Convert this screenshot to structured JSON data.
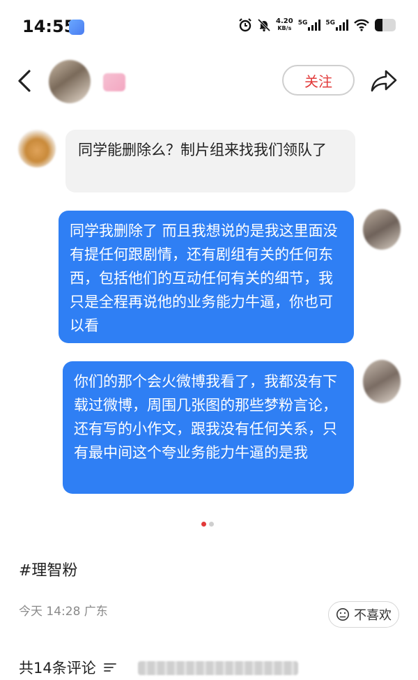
{
  "status_bar": {
    "time": "14:55",
    "net_speed_value": "4.20",
    "net_speed_unit": "KB/s",
    "signal_1": "5G",
    "signal_2": "5G",
    "battery_level": 0.35
  },
  "header": {
    "follow_label": "关注"
  },
  "messages": [
    {
      "side": "left",
      "text": "同学能删除么？制片组来找我们领队了"
    },
    {
      "side": "right",
      "text": "同学我删除了 而且我想说的是我这里面没有提任何跟剧情，还有剧组有关的任何东西，包括他们的互动任何有关的细节，我只是全程再说他的业务能力牛逼，你也可以看"
    },
    {
      "side": "right",
      "text": "你们的那个会火微博我看了，我都没有下载过微博，周围几张图的那些梦粉言论，还有写的小作文，跟我没有任何关系，只有最中间这个夸业务能力牛逼的是我"
    }
  ],
  "carousel": {
    "current": 1,
    "total": 2
  },
  "post": {
    "tag": "#理智粉",
    "meta": "今天 14:28  广东",
    "dislike_label": "不喜欢",
    "comment_count_label": "共14条评论"
  },
  "colors": {
    "accent_red": "#e23a3a",
    "bubble_blue": "#2f7ff4",
    "bubble_gray": "#f2f2f2"
  }
}
